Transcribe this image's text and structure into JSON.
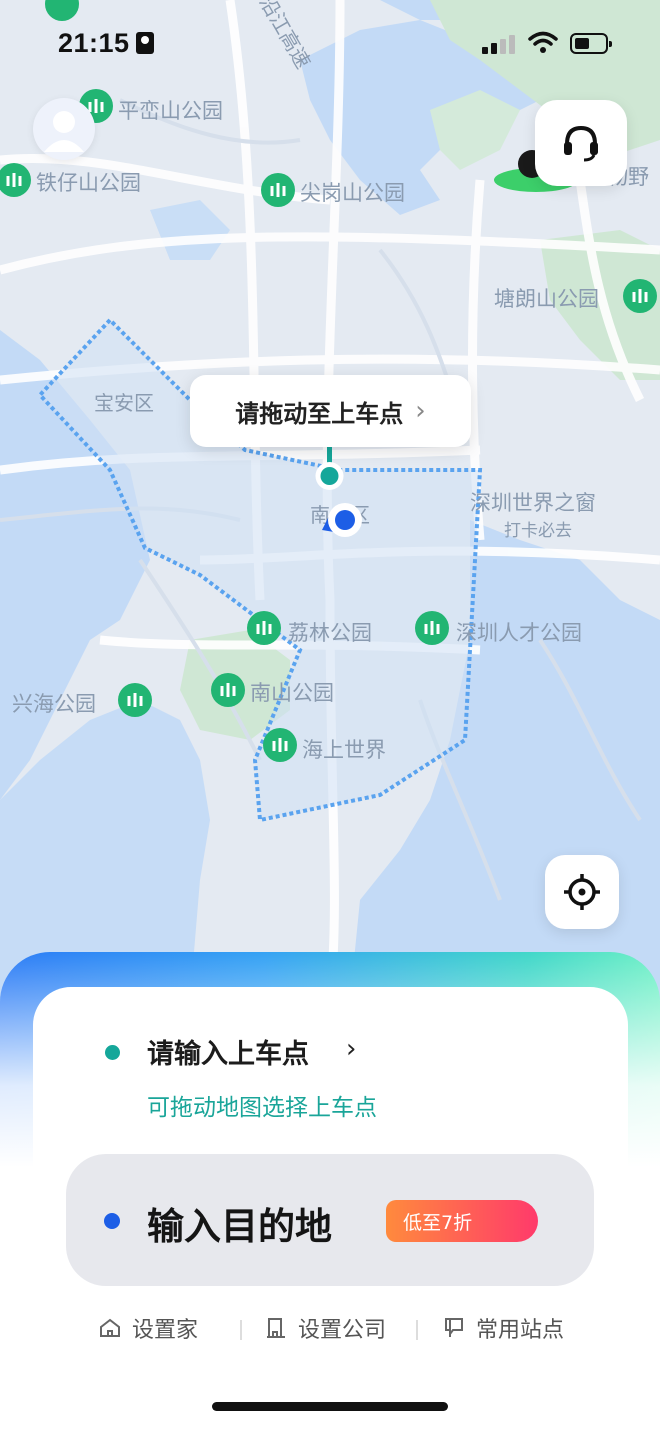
{
  "status_bar": {
    "time": "21:15"
  },
  "map": {
    "road_label": "沿江高速",
    "district_label": "南山区",
    "labels": {
      "pingluanshan": "平峦山公园",
      "tiezaishan": "铁仔山公园",
      "jiangangshan": "尖岗山公园",
      "wild_animal": "动物野",
      "tanglangshan": "塘朗山公园",
      "baoan": "宝安区",
      "window_world": "深圳世界之窗",
      "window_world_sub": "打卡必去",
      "lilin": "荔林公园",
      "talent": "深圳人才公园",
      "xinghai": "兴海公园",
      "nanshan_park": "南山公园",
      "haishang": "海上世界"
    }
  },
  "pickup_tooltip": {
    "label": "请拖动至上车点"
  },
  "panel": {
    "pickup_label": "请输入上车点",
    "pickup_hint": "可拖动地图选择上车点",
    "destination_label": "输入目的地",
    "discount_badge": "低至7折",
    "shortcuts": {
      "home": "设置家",
      "company": "设置公司",
      "stations": "常用站点"
    }
  },
  "colors": {
    "accent_teal": "#15a79a",
    "accent_blue": "#1d5ee6",
    "park_green": "#22b573",
    "map_water": "#c3daf6",
    "map_land": "#e4eaf2"
  },
  "icons": [
    "avatar-icon",
    "headset-icon",
    "locate-icon",
    "home-icon",
    "building-icon",
    "station-icon",
    "tree-icon"
  ]
}
